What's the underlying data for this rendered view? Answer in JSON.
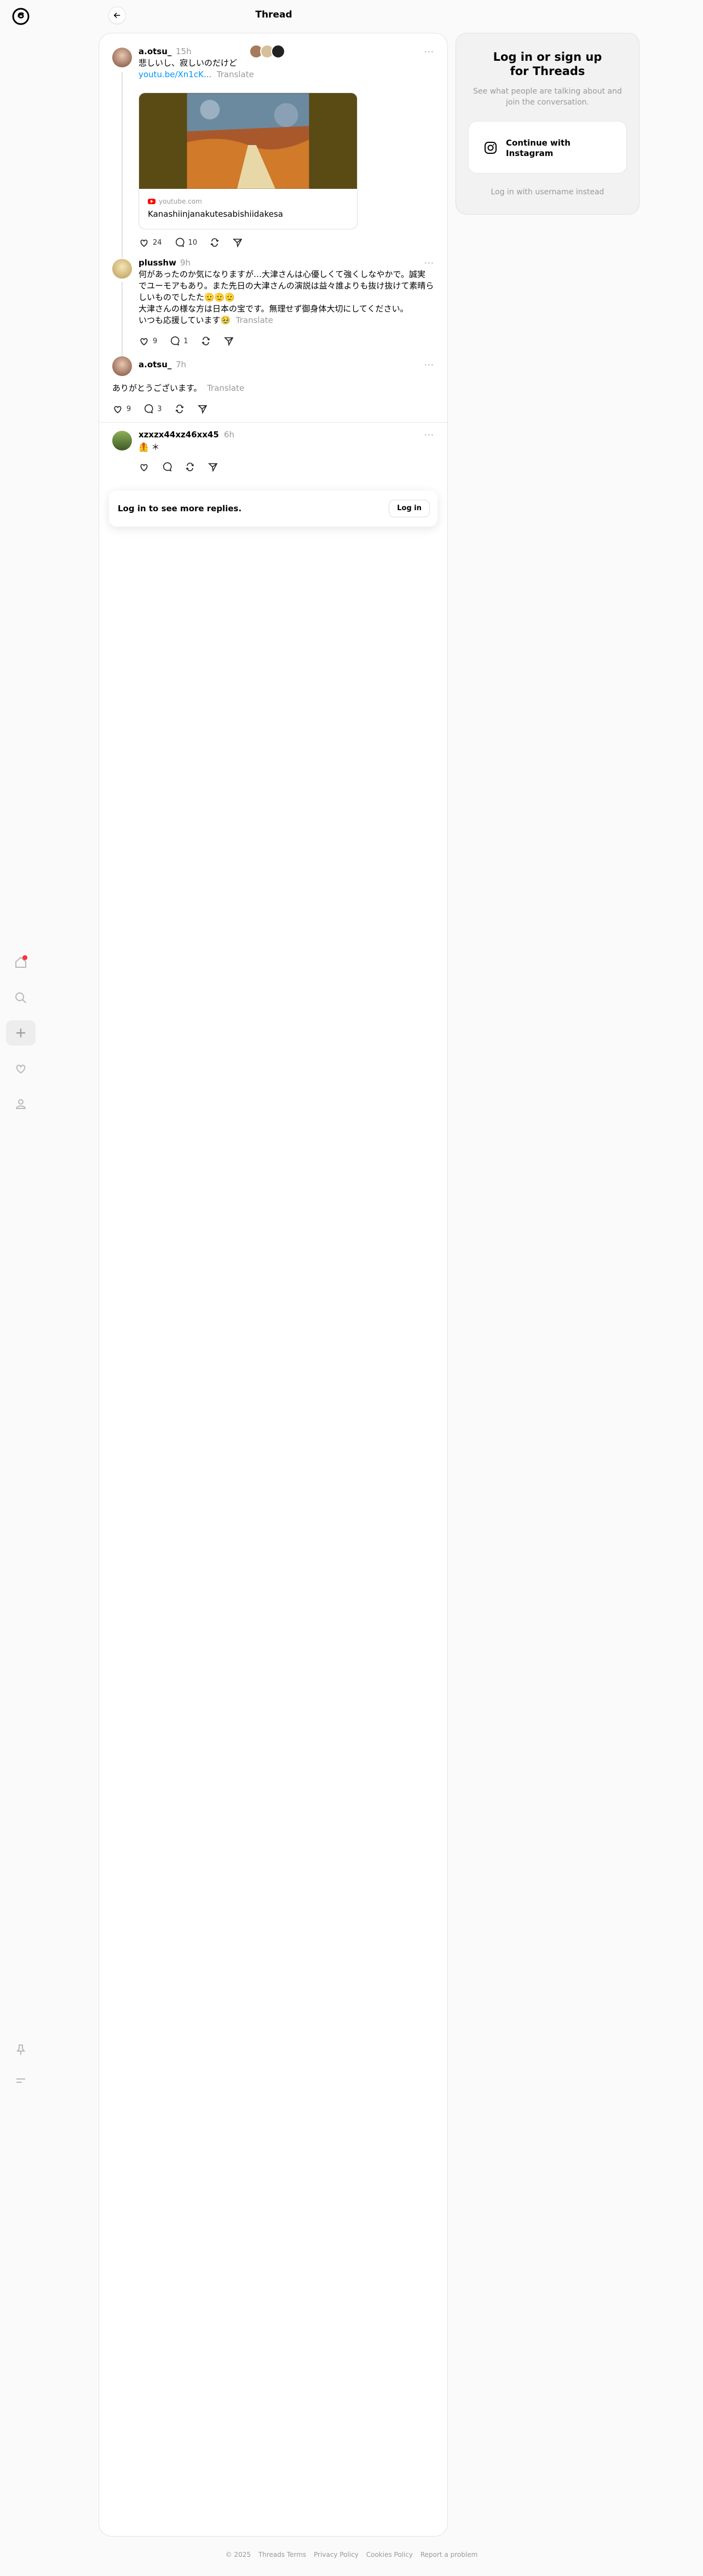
{
  "header": {
    "title": "Thread"
  },
  "post": {
    "author": "a.otsu_",
    "time": "15h",
    "text": "悲しいし、寂しいのだけど",
    "link": "youtu.be/Xn1cK...",
    "translate": "Translate",
    "card": {
      "source": "youtube.com",
      "title": "Kanashiinjanakutesabishiidakesa"
    },
    "likes": "24",
    "replies": "10"
  },
  "reply1": {
    "author": "plusshw",
    "time": "9h",
    "line1": "何があったのか気になりますが…大津さんは心優しくて強くしなやかで。誠実",
    "line2": "でユーモアもあり。また先日の大津さんの演説は益々誰よりも抜け抜けて素晴ら",
    "line3": "しいものでしたた🫡🫡🫡",
    "line4": "大津さんの様な方は日本の宝です。無理せず御身体大切にしてください。",
    "line5": "いつも応援しています🥹",
    "translate": "Translate",
    "likes": "9",
    "replies": "1"
  },
  "reply2": {
    "author": "a.otsu_",
    "time": "7h",
    "text": "ありがとうございます。",
    "translate": "Translate",
    "likes": "9",
    "replies": "3"
  },
  "reply3": {
    "author": "xzxzx44xz46xx45",
    "time": "6h",
    "text": "🦺 ＊"
  },
  "login_bar": {
    "text": "Log in to see more replies.",
    "button": "Log in"
  },
  "panel": {
    "title_line1": "Log in or sign up",
    "title_line2": "for Threads",
    "subtitle": "See what people are talking about and join the conversation.",
    "instagram_button": "Continue with Instagram",
    "alt_login": "Log in with username instead"
  },
  "footer": {
    "copyright": "© 2025",
    "terms": "Threads Terms",
    "privacy": "Privacy Policy",
    "cookies": "Cookies Policy",
    "report": "Report a problem"
  },
  "colors": {
    "link": "#0095f6",
    "notification": "#ff3040",
    "muted": "#999999"
  }
}
